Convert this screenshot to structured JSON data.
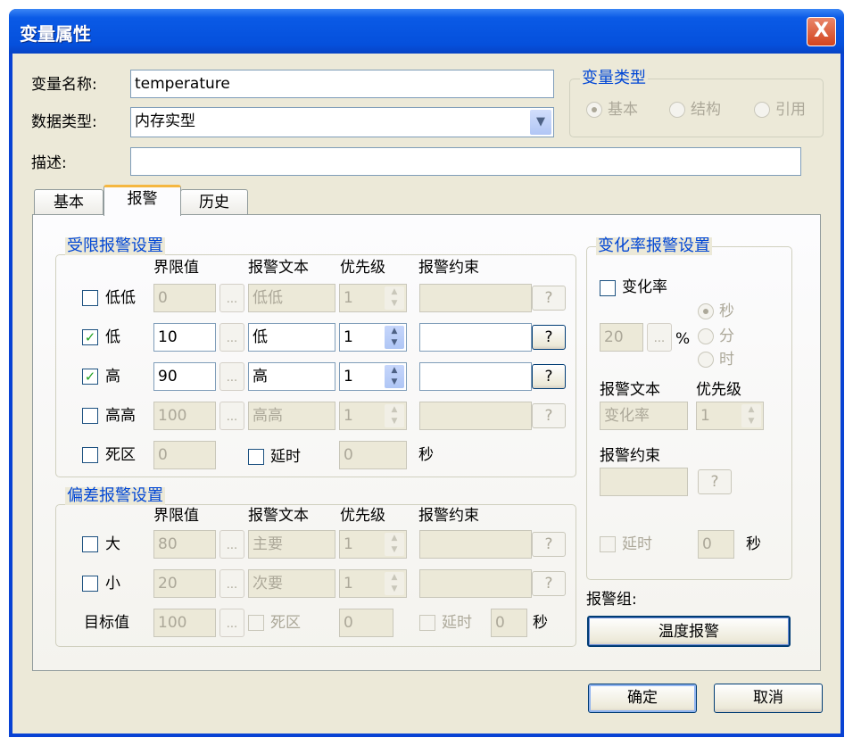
{
  "window": {
    "title": "变量属性",
    "close_label": "X"
  },
  "form": {
    "name_label": "变量名称:",
    "name_value": "temperature",
    "type_label": "数据类型:",
    "type_value": "内存实型",
    "desc_label": "描述:",
    "desc_value": ""
  },
  "var_kind": {
    "legend": "变量类型",
    "options": [
      {
        "label": "基本",
        "selected": true
      },
      {
        "label": "结构",
        "selected": false
      },
      {
        "label": "引用",
        "selected": false
      }
    ]
  },
  "tabs": [
    {
      "label": "基本",
      "selected": false
    },
    {
      "label": "报警",
      "selected": true
    },
    {
      "label": "历史",
      "selected": false
    }
  ],
  "limit": {
    "legend": "受限报警设置",
    "headers": [
      "界限值",
      "报警文本",
      "优先级",
      "报警约束"
    ],
    "rows": [
      {
        "label": "低低",
        "checked": false,
        "value": "0",
        "text": "低低",
        "priority": "1",
        "constraint": ""
      },
      {
        "label": "低",
        "checked": true,
        "value": "10",
        "text": "低",
        "priority": "1",
        "constraint": ""
      },
      {
        "label": "高",
        "checked": true,
        "value": "90",
        "text": "高",
        "priority": "1",
        "constraint": ""
      },
      {
        "label": "高高",
        "checked": false,
        "value": "100",
        "text": "高高",
        "priority": "1",
        "constraint": ""
      }
    ],
    "deadband": {
      "label": "死区",
      "checked": false,
      "value": "0"
    },
    "delay": {
      "label": "延时",
      "checked": false,
      "value": "0",
      "unit": "秒"
    },
    "dots": "...",
    "help": "?"
  },
  "deviation": {
    "legend": "偏差报警设置",
    "headers": [
      "界限值",
      "报警文本",
      "优先级",
      "报警约束"
    ],
    "rows": [
      {
        "label": "大",
        "checked": false,
        "value": "80",
        "text": "主要",
        "priority": "1",
        "constraint": ""
      },
      {
        "label": "小",
        "checked": false,
        "value": "20",
        "text": "次要",
        "priority": "1",
        "constraint": ""
      }
    ],
    "target": {
      "label": "目标值",
      "value": "100",
      "deadband_label": "死区",
      "deadband_value": "0",
      "delay_label": "延时",
      "delay_value": "0",
      "unit": "秒"
    }
  },
  "rate": {
    "legend": "变化率报警设置",
    "check_label": "变化率",
    "checked": false,
    "value": "20",
    "percent": "%",
    "units": [
      {
        "label": "秒",
        "selected": true
      },
      {
        "label": "分",
        "selected": false
      },
      {
        "label": "时",
        "selected": false
      }
    ],
    "text_label": "报警文本",
    "text_value": "变化率",
    "priority_label": "优先级",
    "priority_value": "1",
    "constraint_label": "报警约束",
    "constraint_value": "",
    "delay_label": "延时",
    "delay_value": "0",
    "unit": "秒"
  },
  "alarm_group": {
    "label": "报警组:",
    "button": "温度报警"
  },
  "buttons": {
    "ok": "确定",
    "cancel": "取消"
  }
}
